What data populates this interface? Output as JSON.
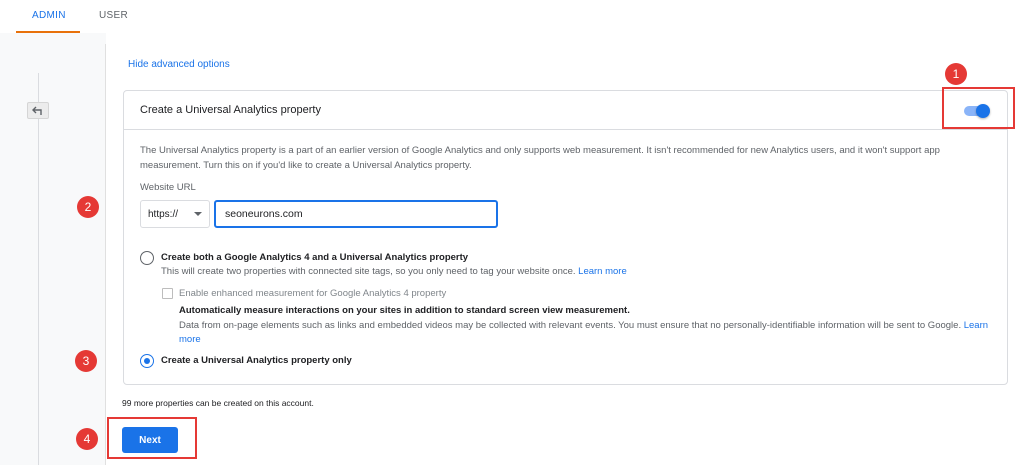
{
  "tabs": [
    {
      "label": "ADMIN",
      "active": true
    },
    {
      "label": "USER",
      "active": false
    }
  ],
  "back_icon": "back-arrow-icon",
  "hide_advanced_link": "Hide advanced options",
  "ua_card": {
    "title": "Create a Universal Analytics property",
    "toggle_on": true,
    "description": "The Universal Analytics property is a part of an earlier version of Google Analytics and only supports web measurement. It isn't recommended for new Analytics users, and it won't support app measurement. Turn this on if you'd like to create a Universal Analytics property.",
    "website_url_label": "Website URL",
    "protocol_value": "https://",
    "url_value": "seoneurons.com",
    "options": [
      {
        "label": "Create both a Google Analytics 4 and a Universal Analytics property",
        "selected": false,
        "sub_text": "This will create two properties with connected site tags, so you only need to tag your website once.",
        "learn_more": "Learn more"
      },
      {
        "label": "Create a Universal Analytics property only",
        "selected": true
      }
    ],
    "enhanced_checkbox": {
      "label": "Enable enhanced measurement for Google Analytics 4 property",
      "checked": false,
      "bold_text": "Automatically measure interactions on your sites in addition to standard screen view measurement.",
      "note": "Data from on-page elements such as links and embedded videos may be collected with relevant events. You must ensure that no personally-identifiable information will be sent to Google.",
      "learn_more": "Learn more"
    }
  },
  "properties_remaining": "99 more properties can be created on this account.",
  "next_button": "Next",
  "annotations": [
    "1",
    "2",
    "3",
    "4"
  ],
  "colors": {
    "accent": "#1a73e8",
    "annotation_red": "#e53935",
    "tab_underline": "#e8710a"
  }
}
